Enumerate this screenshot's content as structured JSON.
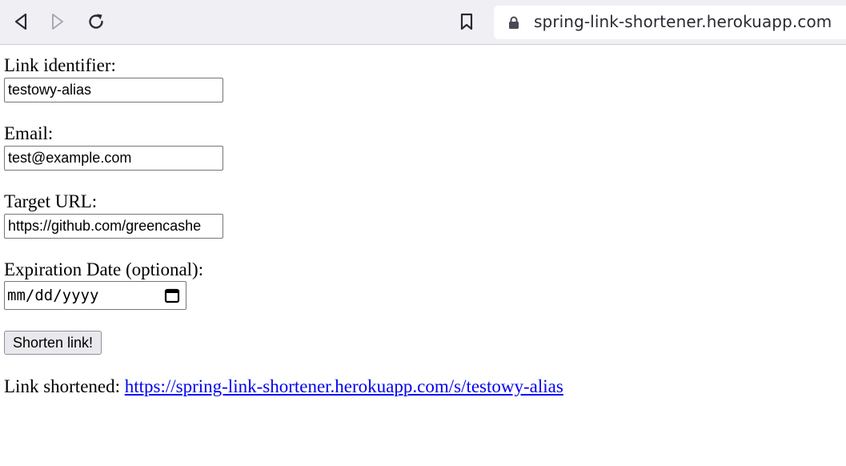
{
  "browser": {
    "url": "spring-link-shortener.herokuapp.com"
  },
  "form": {
    "link_identifier_label": "Link identifier:",
    "link_identifier_value": "testowy-alias",
    "email_label": "Email:",
    "email_value": "test@example.com",
    "target_url_label": "Target URL:",
    "target_url_value": "https://github.com/greencashe",
    "expiration_label": "Expiration Date (optional):",
    "expiration_placeholder": "mm/dd/yyyy",
    "submit_label": "Shorten link!"
  },
  "result": {
    "prefix": "Link shortened: ",
    "link_text": "https://spring-link-shortener.herokuapp.com/s/testowy-alias"
  },
  "colors": {
    "link": "#0000ee",
    "toolbar_bg": "#f0f0f4"
  }
}
